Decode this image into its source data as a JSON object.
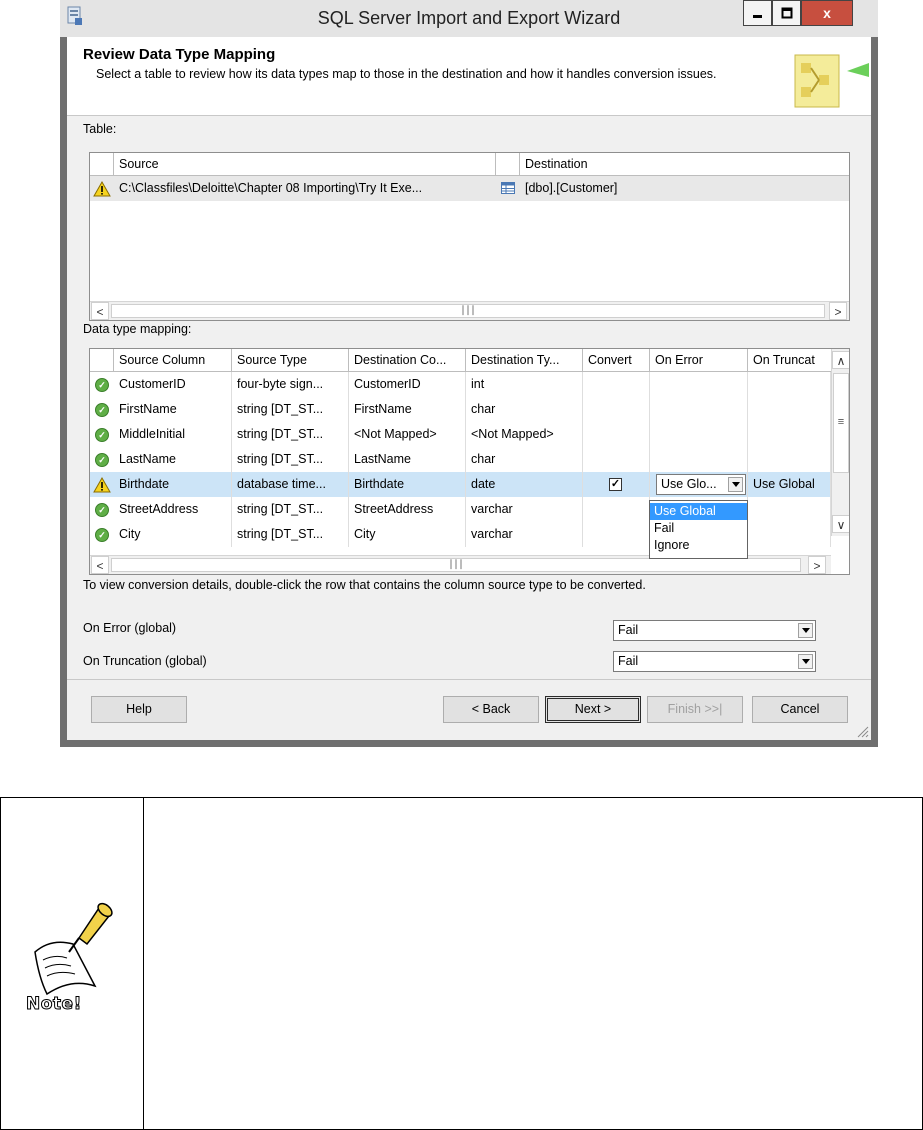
{
  "window": {
    "title": "SQL Server Import and Export Wizard",
    "close_label": "x"
  },
  "header": {
    "title": "Review Data Type Mapping",
    "description": "Select a table to review how its data types map to those in the destination and how it handles conversion issues."
  },
  "table_section": {
    "label": "Table:",
    "columns": [
      "Source",
      "Destination"
    ],
    "rows": [
      {
        "status": "warning",
        "source": "C:\\Classfiles\\Deloitte\\Chapter 08 Importing\\Try It Exe...",
        "destination": "[dbo].[Customer]"
      }
    ]
  },
  "mapping_section": {
    "label": "Data type mapping:",
    "columns": [
      "Source Column",
      "Source Type",
      "Destination Co...",
      "Destination Ty...",
      "Convert",
      "On Error",
      "On Truncat"
    ],
    "rows": [
      {
        "status": "ok",
        "source_column": "CustomerID",
        "source_type": "four-byte sign...",
        "destination_column": "CustomerID",
        "destination_type": "int",
        "convert": "",
        "on_error": "",
        "on_truncation": ""
      },
      {
        "status": "ok",
        "source_column": "FirstName",
        "source_type": "string [DT_ST...",
        "destination_column": "FirstName",
        "destination_type": "char",
        "convert": "",
        "on_error": "",
        "on_truncation": ""
      },
      {
        "status": "ok",
        "source_column": "MiddleInitial",
        "source_type": "string [DT_ST...",
        "destination_column": "<Not Mapped>",
        "destination_type": "<Not Mapped>",
        "convert": "",
        "on_error": "",
        "on_truncation": ""
      },
      {
        "status": "ok",
        "source_column": "LastName",
        "source_type": "string [DT_ST...",
        "destination_column": "LastName",
        "destination_type": "char",
        "convert": "",
        "on_error": "",
        "on_truncation": ""
      },
      {
        "status": "warning",
        "source_column": "Birthdate",
        "source_type": "database time...",
        "destination_column": "Birthdate",
        "destination_type": "date",
        "convert": "checked",
        "on_error": "Use Glo...",
        "on_truncation": "Use Global"
      },
      {
        "status": "ok",
        "source_column": "StreetAddress",
        "source_type": "string [DT_ST...",
        "destination_column": "StreetAddress",
        "destination_type": "varchar",
        "convert": "",
        "on_error": "",
        "on_truncation": ""
      },
      {
        "status": "ok",
        "source_column": "City",
        "source_type": "string [DT_ST...",
        "destination_column": "City",
        "destination_type": "varchar",
        "convert": "",
        "on_error": "",
        "on_truncation": ""
      }
    ],
    "open_dropdown_options": [
      "Use Global",
      "Fail",
      "Ignore"
    ],
    "open_dropdown_selected": "Use Global"
  },
  "hint": "To view conversion details, double-click the row that contains the column source type to be converted.",
  "global_options": {
    "on_error_label": "On Error (global)",
    "on_error_value": "Fail",
    "on_truncation_label": "On Truncation (global)",
    "on_truncation_value": "Fail"
  },
  "buttons": {
    "help": "Help",
    "back": "< Back",
    "next": "Next >",
    "finish": "Finish >>|",
    "cancel": "Cancel"
  },
  "note": {
    "label": "Note!"
  },
  "colors": {
    "selected_row": "#cce4f7",
    "highlight": "#3399ff",
    "close_button": "#c74f3f"
  }
}
